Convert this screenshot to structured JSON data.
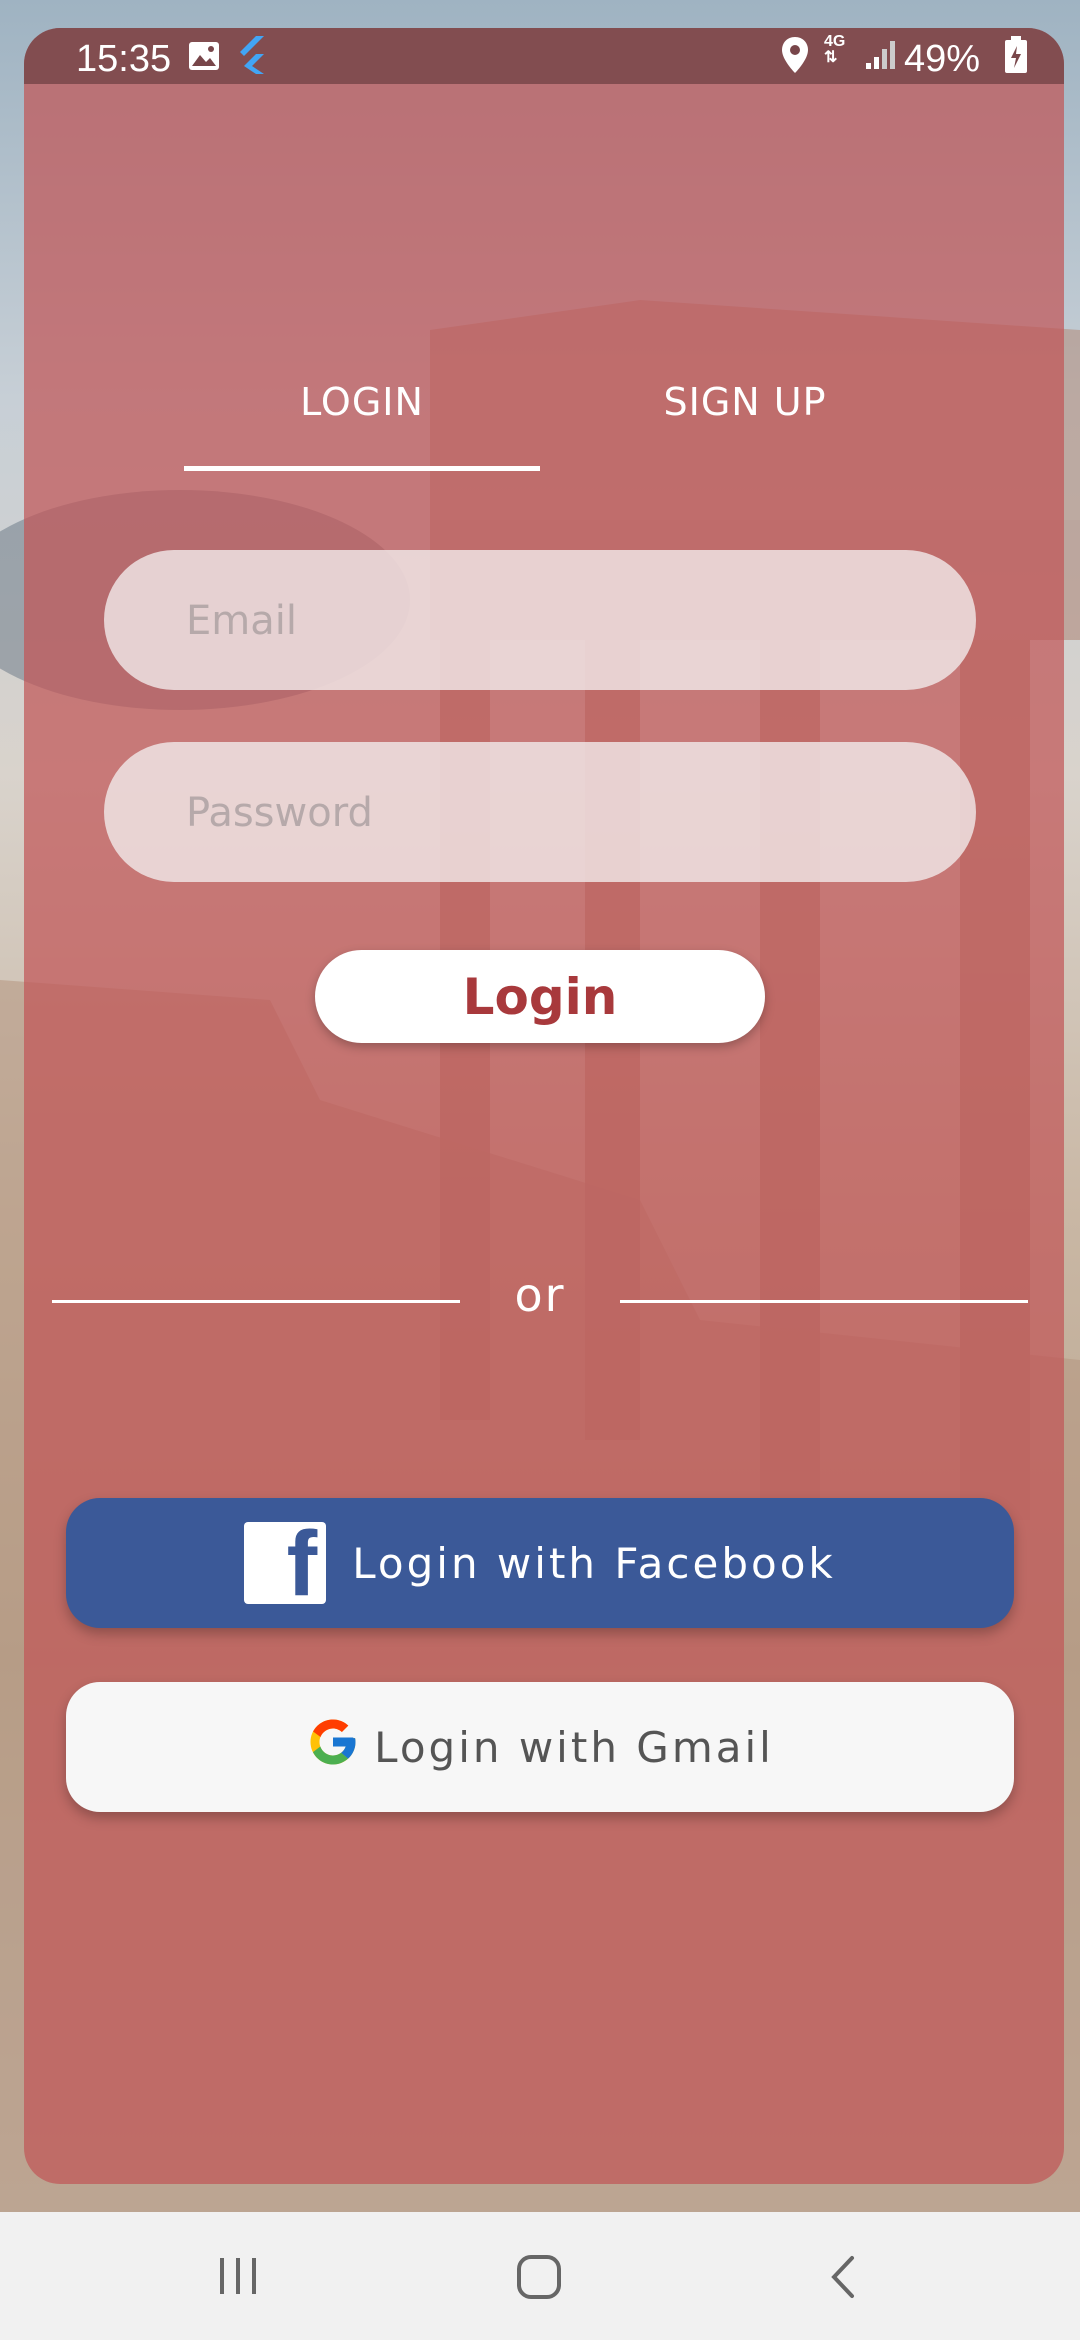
{
  "status_bar": {
    "time": "15:35",
    "network": "4G",
    "battery": "49%",
    "icons": [
      "gallery-icon",
      "flutter-icon",
      "location-icon",
      "network-4g-icon",
      "signal-icon",
      "battery-charging-icon"
    ]
  },
  "tabs": {
    "login": "LOGIN",
    "signup": "SIGN UP",
    "active": "LOGIN"
  },
  "form": {
    "email_placeholder": "Email",
    "email_value": "",
    "password_placeholder": "Password",
    "password_value": "",
    "login_button": "Login"
  },
  "divider": {
    "text": "or"
  },
  "social": {
    "facebook_label": "Login with Facebook",
    "gmail_label": "Login with Gmail"
  },
  "colors": {
    "overlay": "#c05658",
    "login_text": "#a8393c",
    "facebook": "#3b5998",
    "gmail_bg": "#f7f7f7"
  },
  "nav_bar": {
    "icons": [
      "recent-apps-icon",
      "home-icon",
      "back-icon"
    ]
  }
}
